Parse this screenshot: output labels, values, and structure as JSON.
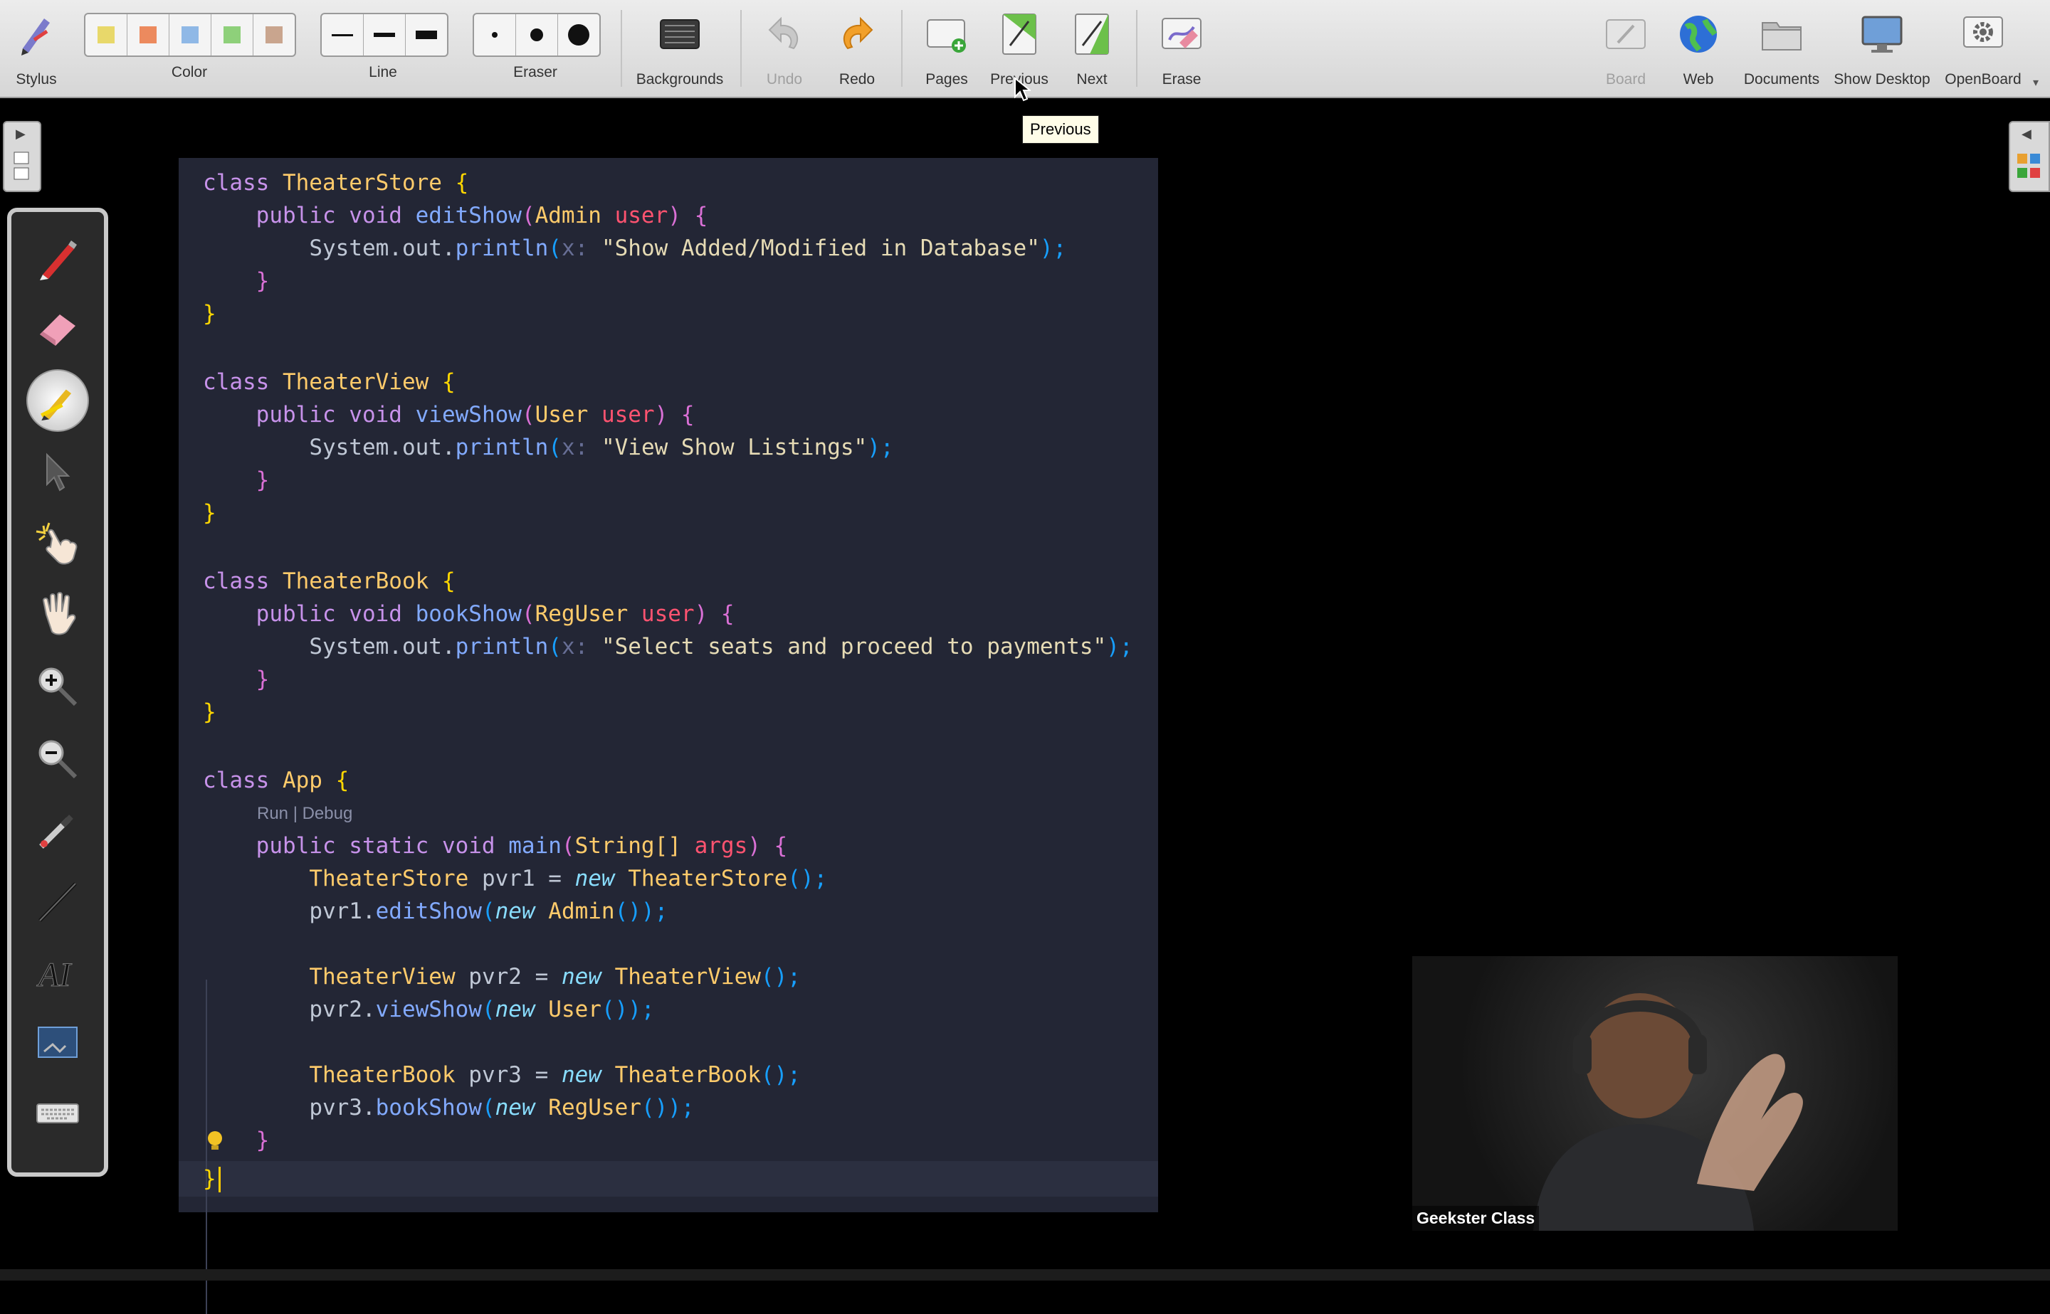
{
  "toolbar": {
    "stylus": "Stylus",
    "color": "Color",
    "line": "Line",
    "eraser": "Eraser",
    "backgrounds": "Backgrounds",
    "undo": "Undo",
    "redo": "Redo",
    "pages": "Pages",
    "previous": "Previous",
    "next": "Next",
    "erase": "Erase",
    "board": "Board",
    "web": "Web",
    "documents": "Documents",
    "show_desktop": "Show Desktop",
    "openboard": "OpenBoard",
    "colors": [
      "#e8d86a",
      "#ec8a5e",
      "#8fb8e6",
      "#8ed07a",
      "#c9a58e"
    ]
  },
  "tooltip": "Previous",
  "code": {
    "l1": [
      "class ",
      "TheaterStore",
      " {"
    ],
    "l2": [
      "public void ",
      "editShow",
      "(",
      "Admin ",
      "user",
      ") {"
    ],
    "l3": [
      "System.out.",
      "println",
      "(",
      "x: ",
      "\"Show Added/Modified in Database\"",
      ");"
    ],
    "l6": [
      "class ",
      "TheaterView",
      " {"
    ],
    "l7": [
      "public void ",
      "viewShow",
      "(",
      "User ",
      "user",
      ") {"
    ],
    "l8": [
      "System.out.",
      "println",
      "(",
      "x: ",
      "\"View Show Listings\"",
      ");"
    ],
    "l11": [
      "class ",
      "TheaterBook",
      " {"
    ],
    "l12": [
      "public void ",
      "bookShow",
      "(",
      "RegUser ",
      "user",
      ") {"
    ],
    "l13": [
      "System.out.",
      "println",
      "(",
      "x: ",
      "\"Select seats and proceed to payments\"",
      ");"
    ],
    "l16": [
      "class ",
      "App",
      " {"
    ],
    "codelens": "Run | Debug",
    "l17": [
      "public static void ",
      "main",
      "(",
      "String[] ",
      "args",
      ") {"
    ],
    "l18": [
      "TheaterStore ",
      "pvr1",
      " = ",
      "new ",
      "TheaterStore",
      "();"
    ],
    "l19": [
      "pvr1.",
      "editShow",
      "(",
      "new ",
      "Admin",
      "());"
    ],
    "l21": [
      "TheaterView ",
      "pvr2",
      " = ",
      "new ",
      "TheaterView",
      "();"
    ],
    "l22": [
      "pvr2.",
      "viewShow",
      "(",
      "new ",
      "User",
      "());"
    ],
    "l24": [
      "TheaterBook ",
      "pvr3",
      " = ",
      "new ",
      "TheaterBook",
      "();"
    ],
    "l25": [
      "pvr3.",
      "bookShow",
      "(",
      "new ",
      "RegUser",
      "());"
    ],
    "close": "}",
    "close_indent": "}"
  },
  "webcam": {
    "name": "Geekster Class"
  }
}
